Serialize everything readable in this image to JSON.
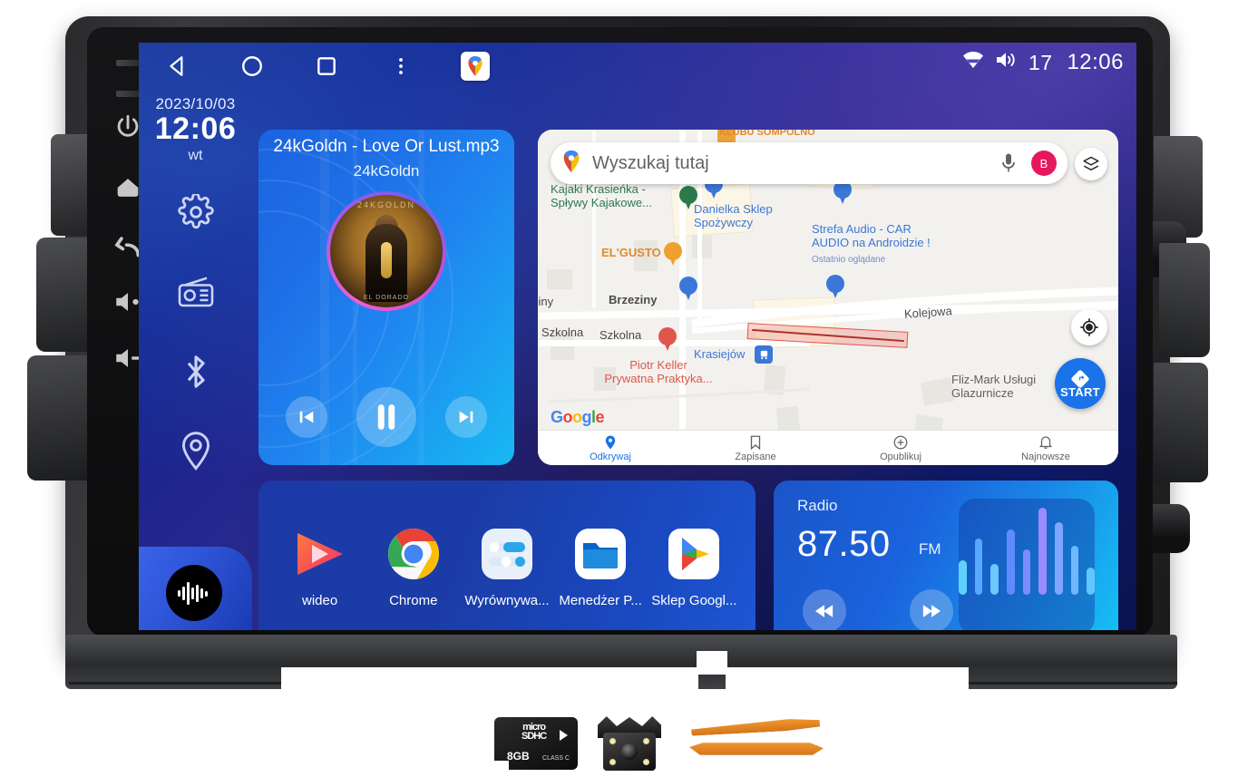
{
  "status_bar": {
    "nav_back": "back-triangle",
    "nav_home": "home-circle",
    "nav_recents": "recents-square",
    "nav_more": "more-vertical",
    "maps_shortcut": "google-maps-badge",
    "wifi_icon": "wifi-icon",
    "volume_icon": "volume-icon",
    "volume_level": "17",
    "clock": "12:06"
  },
  "left_rail": {
    "date": "2023/10/03",
    "time": "12:06",
    "weekday": "wt",
    "icons": [
      {
        "name": "settings-gear-icon"
      },
      {
        "name": "radio-icon"
      },
      {
        "name": "bluetooth-icon"
      },
      {
        "name": "location-pin-icon"
      }
    ],
    "sound_widget": "sound-wave-icon"
  },
  "hardware": {
    "leds": [
      "led-mic",
      "led-rst"
    ],
    "buttons": [
      {
        "name": "power-button"
      },
      {
        "name": "home-button"
      },
      {
        "name": "back-button"
      },
      {
        "name": "volume-up-button"
      },
      {
        "name": "volume-down-button"
      }
    ]
  },
  "music": {
    "title": "24kGoldn - Love Or Lust.mp3",
    "artist": "24kGoldn",
    "album_top_text": "24KGOLDN",
    "album_bottom_text": "EL DORADO",
    "prev_label": "previous-track",
    "play_label": "pause",
    "next_label": "next-track"
  },
  "map": {
    "search_placeholder": "Wyszukaj tutaj",
    "mic_icon": "microphone-icon",
    "avatar_initial": "B",
    "layers_icon": "layers-icon",
    "locate_icon": "my-location-icon",
    "start_label": "START",
    "google_logo": [
      "G",
      "o",
      "o",
      "g",
      "l",
      "e"
    ],
    "labels": [
      {
        "text": "Kajaki Krasieńka -\nSpływy Kajakowe...",
        "color": "green"
      },
      {
        "text": "Danielka Sklep\nSpożywczy",
        "color": "blue"
      },
      {
        "text": "Strefa Audio - CAR\nAUDIO na Androidzie !",
        "color": "blue"
      },
      {
        "text": "Ostatnio oglądane",
        "color": "blue-sub"
      },
      {
        "text": "EL'GUSTO",
        "color": "orange"
      },
      {
        "text": "Piotr Keller\nPrywatna Praktyka...",
        "color": "red"
      },
      {
        "text": "Krasiejów",
        "color": "blue"
      },
      {
        "text": "Fliz-Mark Usługi\nGlazurnicze",
        "color": "gray"
      },
      {
        "text": "KLUBU SOMPOLNO",
        "color": "orange"
      }
    ],
    "streets": [
      "ziny",
      "Brzeziny",
      "Szkolna",
      "Szkolna",
      "Kolejowa"
    ],
    "bottom_nav": [
      {
        "label": "Odkrywaj",
        "icon": "map-pin-icon",
        "active": true
      },
      {
        "label": "Zapisane",
        "icon": "bookmark-icon",
        "active": false
      },
      {
        "label": "Opublikuj",
        "icon": "plus-circle-icon",
        "active": false
      },
      {
        "label": "Najnowsze",
        "icon": "bell-icon",
        "active": false
      }
    ]
  },
  "apps": [
    {
      "label": "wideo",
      "icon": "video-player-icon"
    },
    {
      "label": "Chrome",
      "icon": "chrome-icon"
    },
    {
      "label": "Wyrównywa...",
      "icon": "equalizer-icon"
    },
    {
      "label": "Menedżer P...",
      "icon": "file-manager-icon"
    },
    {
      "label": "Sklep Googl...",
      "icon": "google-play-icon"
    }
  ],
  "radio": {
    "title": "Radio",
    "frequency": "87.50",
    "band": "FM",
    "prev_label": "seek-down",
    "next_label": "seek-up",
    "visualizer_bars": [
      38,
      62,
      34,
      72,
      50,
      96,
      80,
      54,
      30
    ]
  },
  "accessories": {
    "sd_card": {
      "brand_line1": "micro",
      "brand_line2": "SDHC",
      "capacity": "8GB",
      "class": "CLASS C"
    },
    "camera": "reversing-camera",
    "trim_tools": "pry-tools"
  },
  "colors": {
    "screen_bg_start": "#1b2f8f",
    "screen_bg_end": "#0a1350",
    "card_blue": "#1b63e0",
    "card_cyan": "#16c3f5",
    "accent_google": "#1a73e8",
    "avatar_pink": "#e8175d",
    "trim_orange": "#e08a2e"
  }
}
